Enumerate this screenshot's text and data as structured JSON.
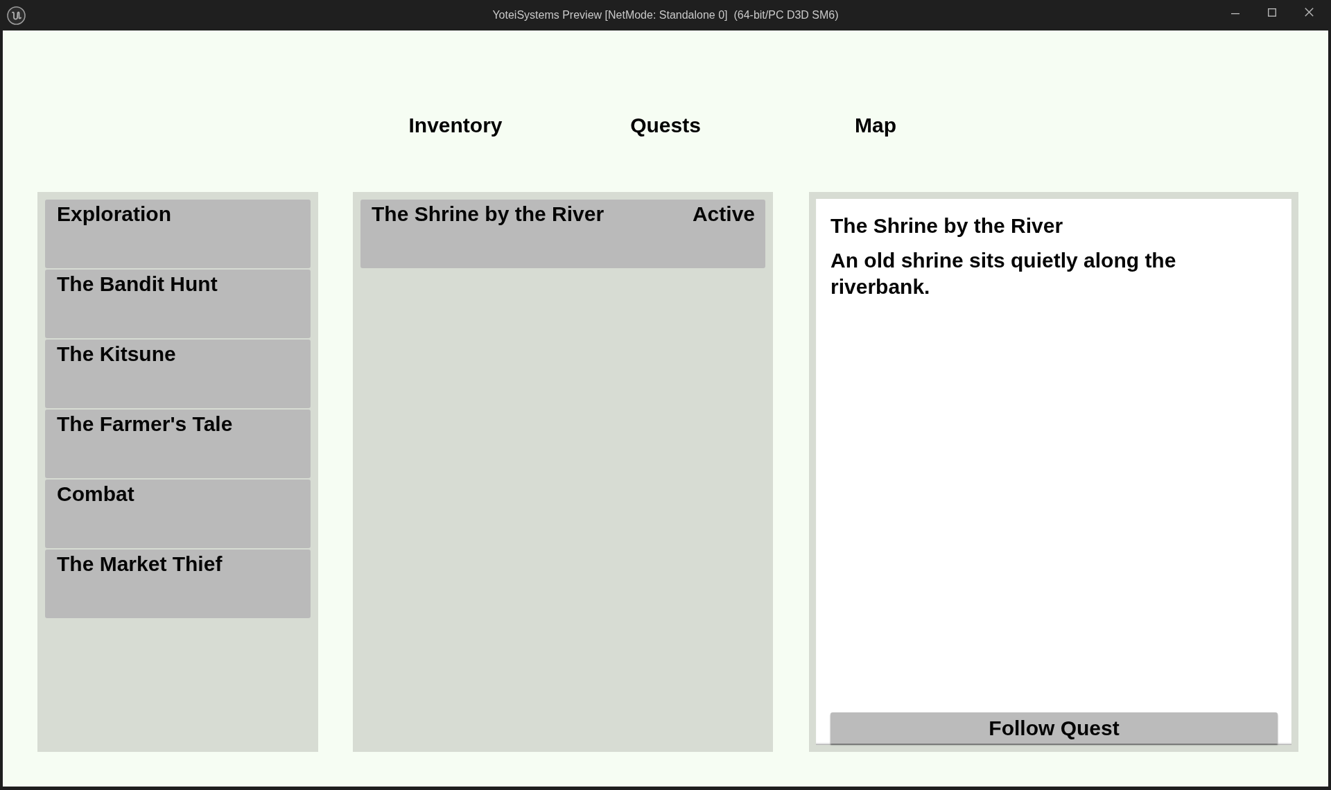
{
  "window": {
    "title": "YoteiSystems Preview [NetMode: Standalone 0]  (64-bit/PC D3D SM6)"
  },
  "tabs": [
    {
      "label": "Inventory"
    },
    {
      "label": "Quests"
    },
    {
      "label": "Map"
    }
  ],
  "categories": [
    {
      "label": "Exploration"
    },
    {
      "label": "The Bandit Hunt"
    },
    {
      "label": "The Kitsune"
    },
    {
      "label": "The Farmer's Tale"
    },
    {
      "label": "Combat"
    },
    {
      "label": "The Market Thief"
    }
  ],
  "quests": [
    {
      "name": "The Shrine by the River",
      "status": "Active"
    }
  ],
  "details": {
    "title": "The Shrine by the River",
    "description": "An old shrine sits quietly along the riverbank.",
    "button": "Follow Quest"
  }
}
